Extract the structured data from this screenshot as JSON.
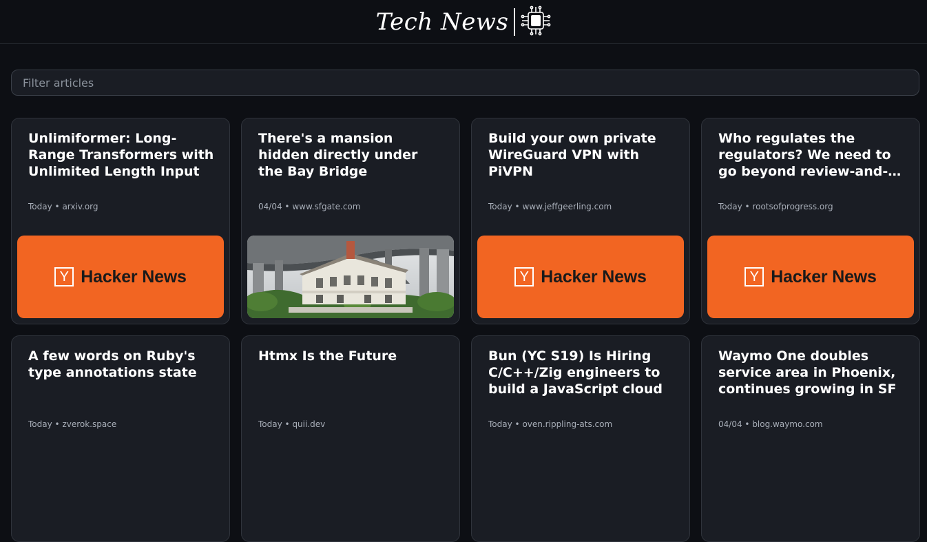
{
  "header": {
    "logo_text": "Tech News",
    "logo_icon": "circuit-chip-icon"
  },
  "filter": {
    "placeholder": "Filter articles",
    "value": ""
  },
  "colors": {
    "background": "#0d0f14",
    "card_background": "#1a1d24",
    "hacker_news_orange": "#f26522"
  },
  "articles": [
    {
      "title": "Unlimiformer: Long-Range Transformers with Unlimited Length Input",
      "date": "Today",
      "source": "arxiv.org",
      "image": "hacker-news-banner",
      "banner_text": "Hacker News",
      "banner_letter": "Y"
    },
    {
      "title": "There's a mansion hidden directly under the Bay Bridge",
      "date": "04/04",
      "source": "www.sfgate.com",
      "image": "mansion-photo"
    },
    {
      "title": "Build your own private WireGuard VPN with PiVPN",
      "date": "Today",
      "source": "www.jeffgeerling.com",
      "image": "hacker-news-banner",
      "banner_text": "Hacker News",
      "banner_letter": "Y"
    },
    {
      "title": "Who regulates the regulators? We need to go beyond review-and-…",
      "date": "Today",
      "source": "rootsofprogress.org",
      "image": "hacker-news-banner",
      "banner_text": "Hacker News",
      "banner_letter": "Y"
    },
    {
      "title": "A few words on Ruby's type annotations state",
      "date": "Today",
      "source": "zverok.space"
    },
    {
      "title": "Htmx Is the Future",
      "date": "Today",
      "source": "quii.dev"
    },
    {
      "title": "Bun (YC S19) Is Hiring C/C++/Zig engineers to build a JavaScript cloud",
      "date": "Today",
      "source": "oven.rippling-ats.com"
    },
    {
      "title": "Waymo One doubles service area in Phoenix, continues growing in SF",
      "date": "04/04",
      "source": "blog.waymo.com"
    }
  ]
}
